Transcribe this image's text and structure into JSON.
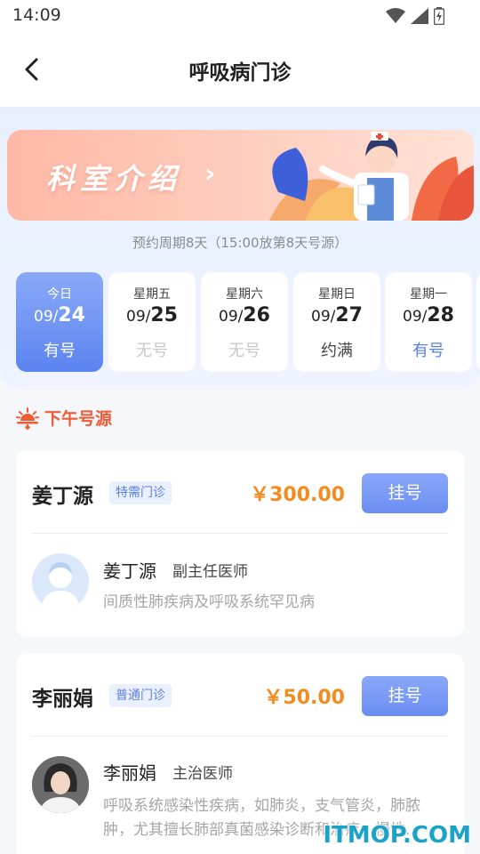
{
  "status_bar": {
    "time": "14:09"
  },
  "header": {
    "title": "呼吸病门诊"
  },
  "banner": {
    "title": "科室介绍"
  },
  "booking_period": "预约周期8天（15:00放第8天号源）",
  "days": [
    {
      "weekday": "今日",
      "month": "09/",
      "day": "24",
      "status": "有号",
      "active": true
    },
    {
      "weekday": "星期五",
      "month": "09/",
      "day": "25",
      "status": "无号"
    },
    {
      "weekday": "星期六",
      "month": "09/",
      "day": "26",
      "status": "无号"
    },
    {
      "weekday": "星期日",
      "month": "09/",
      "day": "27",
      "status": "约满"
    },
    {
      "weekday": "星期一",
      "month": "09/",
      "day": "28",
      "status": "有号"
    }
  ],
  "section": {
    "label": "下午号源"
  },
  "doctors": [
    {
      "name": "姜丁源",
      "clinic_type": "特需门诊",
      "price": "￥300.00",
      "register_label": "挂号",
      "person_name": "姜丁源",
      "title": "副主任医师",
      "description": "间质性肺疾病及呼吸系统罕见病"
    },
    {
      "name": "李丽娟",
      "clinic_type": "普通门诊",
      "price": "￥50.00",
      "register_label": "挂号",
      "person_name": "李丽娟",
      "title": "主治医师",
      "description": "呼吸系统感染性疾病，如肺炎，支气管炎，肺脓肿，尤其擅长肺部真菌感染诊断和治疗，慢性..."
    }
  ],
  "watermark": "ITMOP.COM",
  "colors": {
    "accent_blue": "#6a8df2",
    "available": "#5a7fe0",
    "unavailable": "#c8c8c8",
    "full": "#444444",
    "price": "#f38b1f",
    "section": "#f25a35"
  }
}
